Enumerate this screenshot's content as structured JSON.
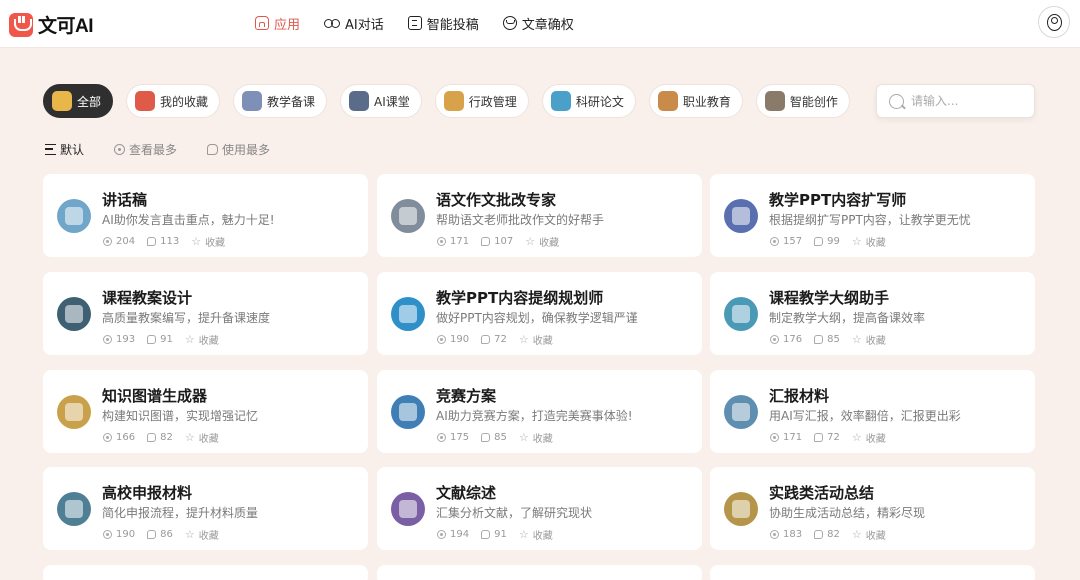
{
  "brand": {
    "name": "文可AI"
  },
  "nav": [
    {
      "label": "应用",
      "icon": "home-icon",
      "active": true
    },
    {
      "label": "AI对话",
      "icon": "infinity-icon",
      "active": false
    },
    {
      "label": "智能投稿",
      "icon": "document-icon",
      "active": false
    },
    {
      "label": "文章确权",
      "icon": "seal-icon",
      "active": false
    }
  ],
  "categories": [
    {
      "label": "全部",
      "active": true,
      "color": "#e9b64a"
    },
    {
      "label": "我的收藏",
      "active": false,
      "color": "#e05a4a"
    },
    {
      "label": "教学备课",
      "active": false,
      "color": "#7e8fb8"
    },
    {
      "label": "AI课堂",
      "active": false,
      "color": "#5b6b8a"
    },
    {
      "label": "行政管理",
      "active": false,
      "color": "#d7a24a"
    },
    {
      "label": "科研论文",
      "active": false,
      "color": "#4aa0c9"
    },
    {
      "label": "职业教育",
      "active": false,
      "color": "#c98a4a"
    },
    {
      "label": "智能创作",
      "active": false,
      "color": "#8a7a6a"
    }
  ],
  "search": {
    "placeholder": "请输入..."
  },
  "sort_tabs": [
    {
      "label": "默认",
      "active": true
    },
    {
      "label": "查看最多",
      "active": false
    },
    {
      "label": "使用最多",
      "active": false
    }
  ],
  "favorite_label": "收藏",
  "cards": [
    {
      "title": "讲话稿",
      "desc": "AI助你发言直击重点，魅力十足!",
      "views": "204",
      "uses": "113",
      "color": "#6fa6c9"
    },
    {
      "title": "语文作文批改专家",
      "desc": "帮助语文老师批改作文的好帮手",
      "views": "171",
      "uses": "107",
      "color": "#7f8e9a"
    },
    {
      "title": "教学PPT内容扩写师",
      "desc": "根据提纲扩写PPT内容，让教学更无忧",
      "views": "157",
      "uses": "99",
      "color": "#5a6fb0"
    },
    {
      "title": "课程教案设计",
      "desc": "高质量教案编写，提升备课速度",
      "views": "193",
      "uses": "91",
      "color": "#3f5f73"
    },
    {
      "title": "教学PPT内容提纲规划师",
      "desc": "做好PPT内容规划，确保教学逻辑严谨",
      "views": "190",
      "uses": "72",
      "color": "#2f8fc9"
    },
    {
      "title": "课程教学大纲助手",
      "desc": "制定教学大纲，提高备课效率",
      "views": "176",
      "uses": "85",
      "color": "#4a9ab5"
    },
    {
      "title": "知识图谱生成器",
      "desc": "构建知识图谱，实现增强记忆",
      "views": "166",
      "uses": "82",
      "color": "#c9a14a"
    },
    {
      "title": "竞赛方案",
      "desc": "AI助力竞赛方案，打造完美赛事体验!",
      "views": "175",
      "uses": "85",
      "color": "#3f7fb5"
    },
    {
      "title": "汇报材料",
      "desc": "用AI写汇报，效率翻倍，汇报更出彩",
      "views": "171",
      "uses": "72",
      "color": "#5f8fb0"
    },
    {
      "title": "高校申报材料",
      "desc": "简化申报流程，提升材料质量",
      "views": "190",
      "uses": "86",
      "color": "#4f7f95"
    },
    {
      "title": "文献综述",
      "desc": "汇集分析文献，了解研究现状",
      "views": "194",
      "uses": "91",
      "color": "#7a5fa5"
    },
    {
      "title": "实践类活动总结",
      "desc": "协助生成活动总结，精彩尽现",
      "views": "183",
      "uses": "82",
      "color": "#b5954a"
    }
  ]
}
